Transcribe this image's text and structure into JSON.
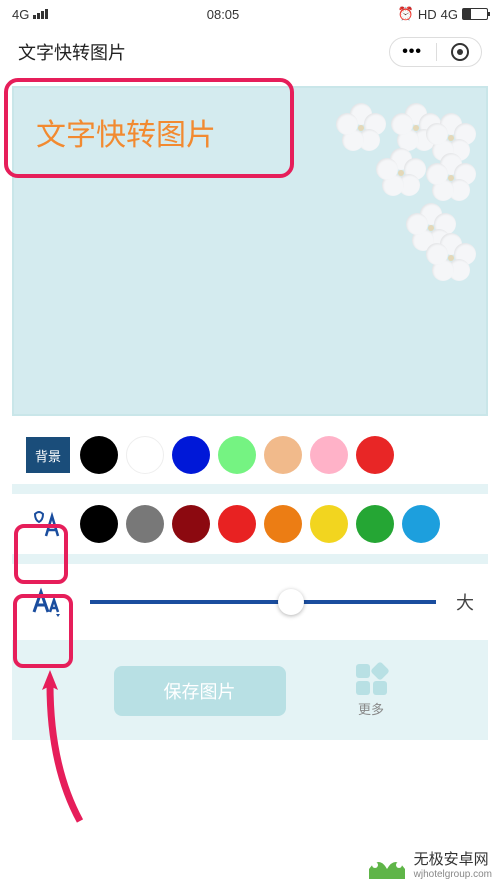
{
  "status": {
    "network": "4G",
    "time": "08:05",
    "hd": "HD",
    "net2": "4G"
  },
  "header": {
    "title": "文字快转图片"
  },
  "canvas": {
    "text": "文字快转图片"
  },
  "bgRow": {
    "label": "背景",
    "colors": [
      "#000000",
      "#ffffff",
      "#0018d8",
      "#75f382",
      "#f1ba8b",
      "#ffb2c8",
      "#e82626"
    ]
  },
  "colorRow": {
    "colors": [
      "#000000",
      "#787878",
      "#8c0910",
      "#e82222",
      "#ec7d14",
      "#f2d51f",
      "#25a634",
      "#1d9fdd"
    ]
  },
  "sizeRow": {
    "label": "大"
  },
  "actions": {
    "save": "保存图片",
    "more": "更多"
  },
  "watermark": {
    "title": "无极安卓网",
    "sub": "wjhotelgroup.com"
  }
}
